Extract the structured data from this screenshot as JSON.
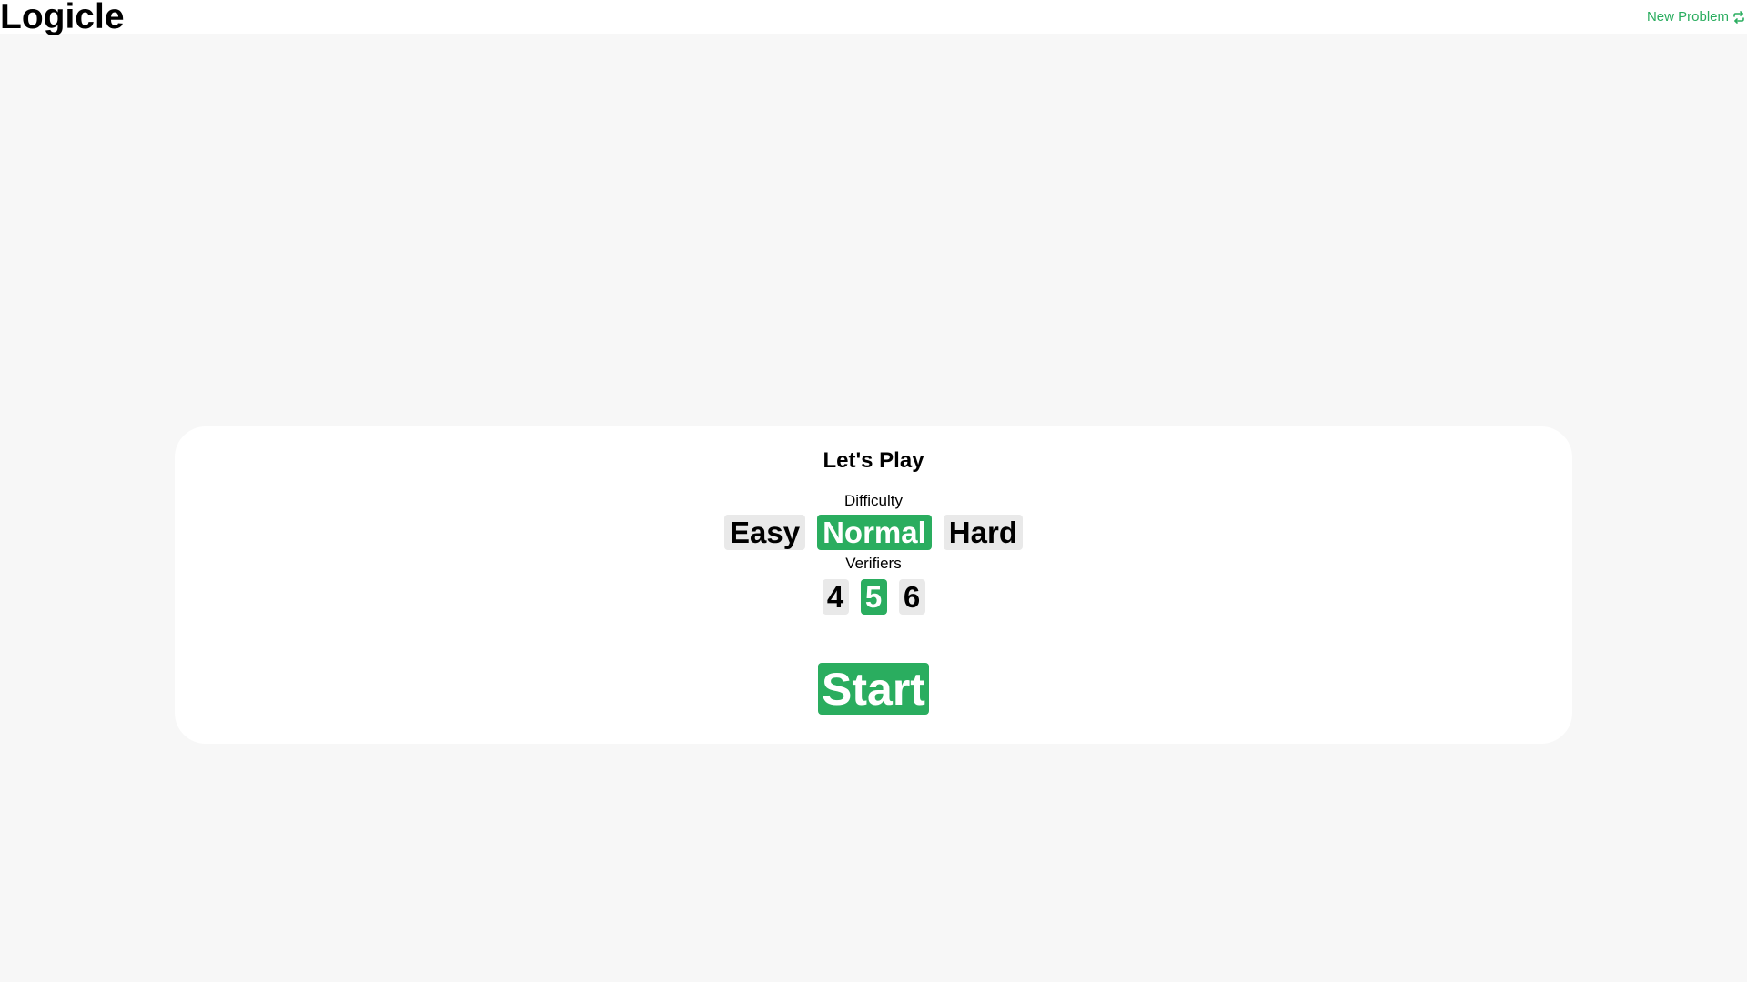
{
  "header": {
    "title": "Logicle",
    "new_problem_label": "New Problem",
    "new_problem_icon": "refresh-icon"
  },
  "setup": {
    "title": "Let's Play",
    "difficulty_label": "Difficulty",
    "difficulty_options": [
      "Easy",
      "Normal",
      "Hard"
    ],
    "selected_difficulty": "Normal",
    "verifiers_label": "Verifiers",
    "verifier_options": [
      "4",
      "5",
      "6"
    ],
    "selected_verifiers": "5",
    "start_label": "Start"
  },
  "colors": {
    "accent": "#2aad5f",
    "option_bg": "#e9e9e9",
    "page_bg": "#f7f7f7",
    "card_bg": "#ffffff"
  }
}
